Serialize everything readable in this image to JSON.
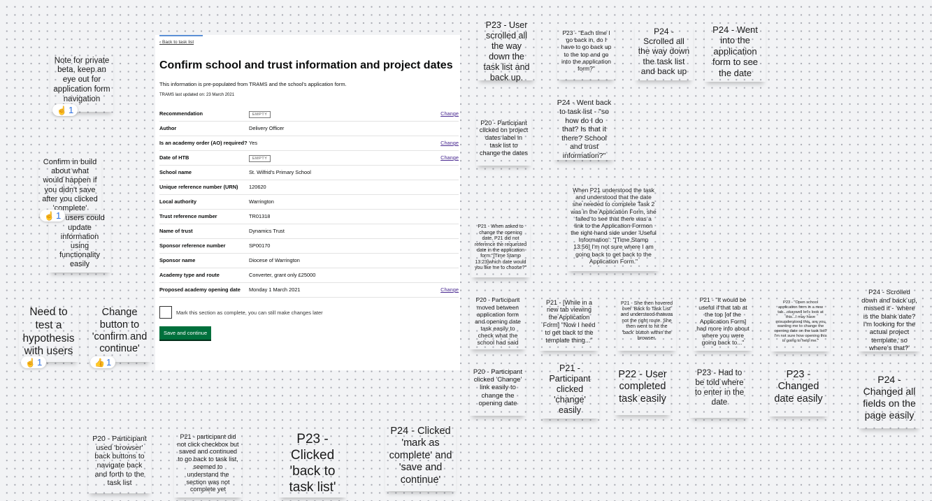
{
  "form": {
    "back_link": "Back to task list",
    "title": "Confirm school and trust information and project dates",
    "intro": "This information is pre-populated from TRAMS and the school's application form.",
    "updated": "TRAMS last updated on: 23 March 2021",
    "rows": [
      {
        "label": "Recommendation",
        "value": "EMPTY",
        "change": "Change"
      },
      {
        "label": "Author",
        "value": "Delivery Officer",
        "change": ""
      },
      {
        "label": "Is an academy order (AO) required?",
        "value": "Yes",
        "change": "Change"
      },
      {
        "label": "Date of HTB",
        "value": "EMPTY",
        "change": "Change"
      },
      {
        "label": "School name",
        "value": "St. Wilfrid's Primary School",
        "change": ""
      },
      {
        "label": "Unique reference number (URN)",
        "value": "120620",
        "change": ""
      },
      {
        "label": "Local authority",
        "value": "Warrington",
        "change": ""
      },
      {
        "label": "Trust reference number",
        "value": "TR01318",
        "change": ""
      },
      {
        "label": "Name of trust",
        "value": "Dynamics Trust",
        "change": ""
      },
      {
        "label": "Sponsor reference number",
        "value": "SP00170",
        "change": ""
      },
      {
        "label": "Sponsor name",
        "value": "Diocese of Warrington",
        "change": ""
      },
      {
        "label": "Academy type and route",
        "value": "Converter, grant only £25000",
        "change": ""
      },
      {
        "label": "Proposed academy opening date",
        "value": "Monday 1 March 2021",
        "change": "Change"
      }
    ],
    "checkbox_label": "Mark this section as complete, you can still make changes later",
    "save_button": "Save and continue"
  },
  "notes": [
    {
      "text": "Note for private beta, keep an eye out for application form navigation",
      "color": "#f5c6d9"
    },
    {
      "text": "Confirm in build about what would happen if you didn't save after you clicked 'complete'",
      "color": "#f5c6d9"
    },
    {
      "text": "All users could update information using functionality easily",
      "color": "#5bc2bf"
    },
    {
      "text": "Need to test a hypothesis with users",
      "color": "#dedede"
    },
    {
      "text": "Change button to 'confirm and continue'",
      "color": "#f5c6d9"
    },
    {
      "text": "P20 - Participant used 'browser' back buttons to navigate back and forth to the task list",
      "color": "#c6eca3"
    },
    {
      "text": "P21 - participant did not click checkbox but saved and continued to go back to task list, seemed to understand the section was not complete yet",
      "color": "#d9d8e5"
    },
    {
      "text": "P23 - Clicked 'back to task list'",
      "color": "#a9cbe9"
    },
    {
      "text": "P24 - Clicked 'mark as complete' and 'save and continue'",
      "color": "#f7a98f"
    },
    {
      "text": "P23 - User scrolled all the way down the task list and back up.",
      "color": "#a9cbe9"
    },
    {
      "text": "P23 - \"Each time I go back in, do I have to go back up to the top and go into the application form?\"",
      "color": "#a9cbe9"
    },
    {
      "text": "P24 - Scrolled all the way down the task list and back up",
      "color": "#f7a98f"
    },
    {
      "text": "P24 - Went into the application form to see the date",
      "color": "#f7a98f"
    },
    {
      "text": "P20 - Participant clicked on project dates label in task list to change the dates",
      "color": "#c6eca3"
    },
    {
      "text": "P24 - Went back to task list - \"so how do I do that? Is that it there? School and trust information?\"",
      "color": "#f7a98f"
    },
    {
      "text": "When P21 understood the task and understood that the date she needed to complete Task 2 was in the Application Form, she failed to see that there was a link to the Application Formon the right-hand side under 'Useful Information': \"[Time Stamp 13:56] I'm not sure where I am going back to get back to the Application Form.\"",
      "color": "#d9d8e5"
    },
    {
      "text": "P21 - When asked to change the opening date, P21 did not reference the requested date in the application form:\"[Time Stamp 13:23]which date would you like me to choose?\"",
      "color": "#d9d8e5"
    },
    {
      "text": "P20 - Participant moved between application form and opening date task easily to check what the school had said",
      "color": "#c6eca3"
    },
    {
      "text": "P21 - [While in a new tab viewing the Application Form] \"Now I need to get back to the template thing...\"",
      "color": "#d9d8e5"
    },
    {
      "text": "P21 - She then hovered over 'Back to Task List' and understood thatwas not the right route. She then went to hit the 'back' button within the browser.",
      "color": "#d9d8e5"
    },
    {
      "text": "P21 - \"It would be useful if that tab at the top [of the Application Form] had more info about where you were going back to...\"",
      "color": "#d9d8e5"
    },
    {
      "text": "P23 - \"Open school application form in a new tab...okaywell let's look at this...I may have misunderstood this, are you wanting me to change the opening date on the task list? I'm not sure how opening this is going to help me.\"",
      "color": "#a9cbe9"
    },
    {
      "text": "P24 - Scrolled down and back up, missed it - 'where is the blank date? I'm looking for the actual project template, so where's that?'",
      "color": "#f7a98f"
    },
    {
      "text": "P20 - Participant clicked 'Change' link easily to change the opening date",
      "color": "#c6eca3"
    },
    {
      "text": "P21 - Participant clicked 'change' easily",
      "color": "#d9d8e5"
    },
    {
      "text": "P22 - User completed task easily",
      "color": "#b4dfc7"
    },
    {
      "text": "P23 - Had to be told where to enter in the date",
      "color": "#a9cbe9"
    },
    {
      "text": "P23 - Changed date easily",
      "color": "#a9cbe9"
    },
    {
      "text": "P24 - Changed all fields on the page easily",
      "color": "#f7a98f"
    }
  ],
  "reactions": [
    {
      "icon": "pointing-up-hand",
      "count": "1"
    },
    {
      "icon": "pointing-up-hand",
      "count": "1"
    },
    {
      "icon": "pointing-up-hand",
      "count": "1"
    },
    {
      "icon": "thumbs-up",
      "count": "1"
    }
  ]
}
